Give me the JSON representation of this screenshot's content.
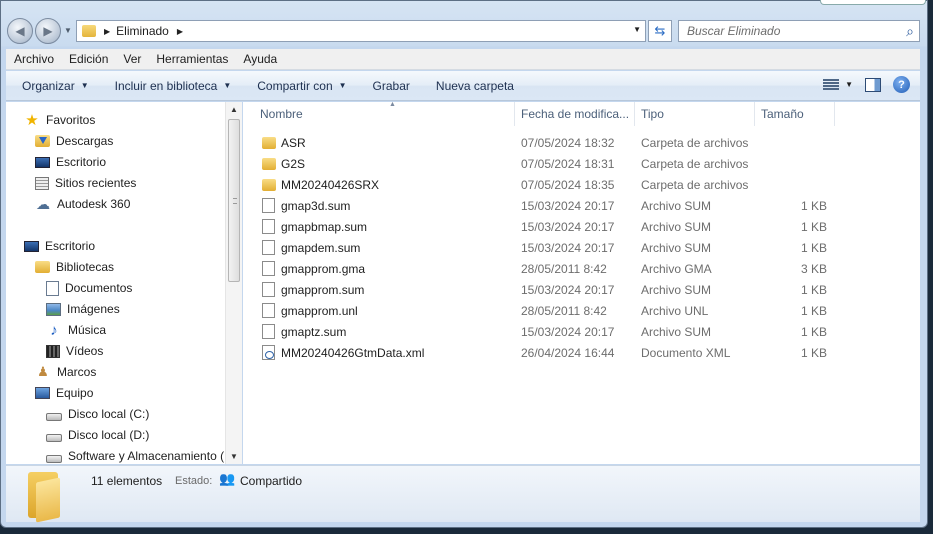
{
  "address": {
    "crumb": "Eliminado"
  },
  "search": {
    "placeholder": "Buscar Eliminado"
  },
  "menu": [
    "Archivo",
    "Edición",
    "Ver",
    "Herramientas",
    "Ayuda"
  ],
  "toolbar": {
    "organize": "Organizar",
    "include": "Incluir en biblioteca",
    "share": "Compartir con",
    "burn": "Grabar",
    "new_folder": "Nueva carpeta"
  },
  "nav": {
    "favorites": "Favoritos",
    "downloads": "Descargas",
    "desktop_fav": "Escritorio",
    "recent": "Sitios recientes",
    "autodesk": "Autodesk 360",
    "desktop": "Escritorio",
    "libraries": "Bibliotecas",
    "documents": "Documentos",
    "images": "Imágenes",
    "music": "Música",
    "videos": "Vídeos",
    "user": "Marcos",
    "computer": "Equipo",
    "drive_c": "Disco local (C:)",
    "drive_d": "Disco local (D:)",
    "drive_other": "Software y Almacenamiento ("
  },
  "columns": {
    "name": "Nombre",
    "date": "Fecha de modifica...",
    "type": "Tipo",
    "size": "Tamaño"
  },
  "files": [
    {
      "name": "ASR",
      "date": "07/05/2024 18:32",
      "type": "Carpeta de archivos",
      "size": "",
      "icon": "folder-icon"
    },
    {
      "name": "G2S",
      "date": "07/05/2024 18:31",
      "type": "Carpeta de archivos",
      "size": "",
      "icon": "folder-icon"
    },
    {
      "name": "MM20240426SRX",
      "date": "07/05/2024 18:35",
      "type": "Carpeta de archivos",
      "size": "",
      "icon": "folder-icon"
    },
    {
      "name": "gmap3d.sum",
      "date": "15/03/2024 20:17",
      "type": "Archivo SUM",
      "size": "1 KB",
      "icon": "file-icon"
    },
    {
      "name": "gmapbmap.sum",
      "date": "15/03/2024 20:17",
      "type": "Archivo SUM",
      "size": "1 KB",
      "icon": "file-icon"
    },
    {
      "name": "gmapdem.sum",
      "date": "15/03/2024 20:17",
      "type": "Archivo SUM",
      "size": "1 KB",
      "icon": "file-icon"
    },
    {
      "name": "gmapprom.gma",
      "date": "28/05/2011 8:42",
      "type": "Archivo GMA",
      "size": "3 KB",
      "icon": "file-icon"
    },
    {
      "name": "gmapprom.sum",
      "date": "15/03/2024 20:17",
      "type": "Archivo SUM",
      "size": "1 KB",
      "icon": "file-icon"
    },
    {
      "name": "gmapprom.unl",
      "date": "28/05/2011 8:42",
      "type": "Archivo UNL",
      "size": "1 KB",
      "icon": "file-icon"
    },
    {
      "name": "gmaptz.sum",
      "date": "15/03/2024 20:17",
      "type": "Archivo SUM",
      "size": "1 KB",
      "icon": "file-icon"
    },
    {
      "name": "MM20240426GtmData.xml",
      "date": "26/04/2024 16:44",
      "type": "Documento XML",
      "size": "1 KB",
      "icon": "xml-file-icon"
    }
  ],
  "status": {
    "count": "11 elementos",
    "state_label": "Estado:",
    "state_value": "Compartido"
  }
}
